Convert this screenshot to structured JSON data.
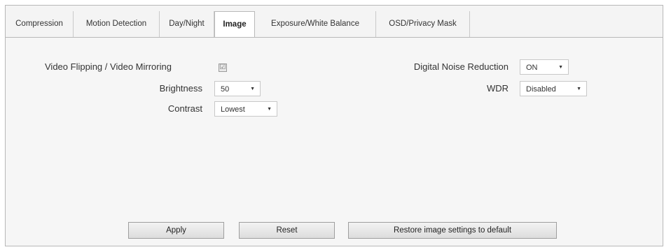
{
  "tabs": [
    {
      "label": "Compression"
    },
    {
      "label": "Motion Detection"
    },
    {
      "label": "Day/Night"
    },
    {
      "label": "Image"
    },
    {
      "label": "Exposure/White Balance"
    },
    {
      "label": "OSD/Privacy Mask"
    }
  ],
  "active_tab": "Image",
  "image_settings": {
    "flip_label": "Video Flipping",
    "separator": "/",
    "mirror_label": "Video Mirroring",
    "flip_mirror_checked": true,
    "checkbox_glyph": "☑",
    "brightness_label": "Brightness",
    "brightness_value": "50",
    "contrast_label": "Contrast",
    "contrast_value": "Lowest",
    "dnr_label": "Digital Noise Reduction",
    "dnr_value": "ON",
    "wdr_label": "WDR",
    "wdr_value": "Disabled",
    "dropdown_arrow": "▼"
  },
  "buttons": {
    "apply": "Apply",
    "reset": "Reset",
    "restore": "Restore image settings to default"
  }
}
